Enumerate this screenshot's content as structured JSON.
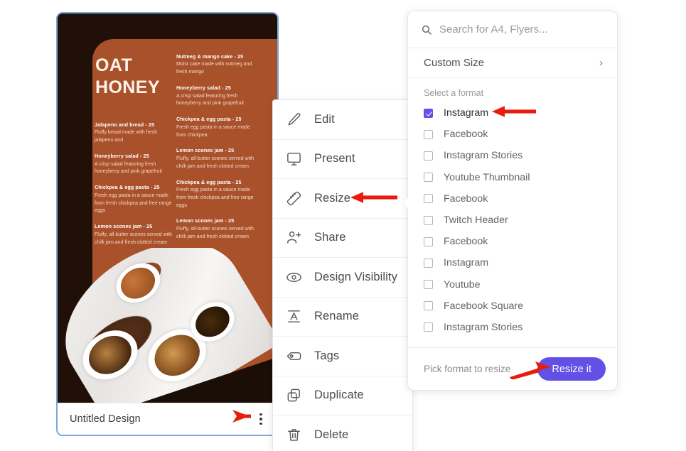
{
  "design_card": {
    "title": "Untitled Design",
    "kebab_icon": "more-vertical-icon",
    "thumbnail": {
      "brand_line1": "OAT",
      "brand_line2": "HONEY",
      "column_left": [
        {
          "title": "Jalapeno and bread - 25",
          "desc": "Fluffy bread made with fresh jalapeno and"
        },
        {
          "title": "Honeyberry salad - 25",
          "desc": "A crisp salad featuring fresh honeyberry and pink grapefruit"
        },
        {
          "title": "Chickpea & egg pasta - 25",
          "desc": "Fresh egg pasta in a sauce made from fresh chickpea and free range eggs"
        },
        {
          "title": "Lemon scones  jam - 25",
          "desc": "Fluffy, all-butter scones served with chilli jam and fresh clotted cream"
        }
      ],
      "column_right": [
        {
          "title": "Nutmeg & mango cake - 25",
          "desc": "Moist cake made with nutmeg and fresh mango"
        },
        {
          "title": "Honeyberry salad - 25",
          "desc": "A crisp salad featuring fresh honeyberry and pink grapefruit"
        },
        {
          "title": "Chickpea & egg pasta - 25",
          "desc": "Fresh egg pasta in a sauce made from chickpea"
        },
        {
          "title": "Lemon scones  jam - 25",
          "desc": "Fluffy, all-butter scones served with chilli jam and fresh clotted cream"
        },
        {
          "title": "Chickpea & egg pasta - 25",
          "desc": "Fresh egg pasta in a sauce made from fresh chickpea and free range eggs"
        },
        {
          "title": "Lemon scones  jam - 25",
          "desc": "Fluffy, all-butter scones served with chilli jam and fresh clotted cream"
        }
      ]
    }
  },
  "context_menu": {
    "items": [
      {
        "label": "Edit",
        "icon": "pencil-icon"
      },
      {
        "label": "Present",
        "icon": "monitor-icon"
      },
      {
        "label": "Resize",
        "icon": "ruler-icon"
      },
      {
        "label": "Share",
        "icon": "person-plus-icon"
      },
      {
        "label": "Design Visibility",
        "icon": "eye-icon"
      },
      {
        "label": "Rename",
        "icon": "text-a-icon"
      },
      {
        "label": "Tags",
        "icon": "tag-icon"
      },
      {
        "label": "Duplicate",
        "icon": "copy-icon"
      },
      {
        "label": "Delete",
        "icon": "trash-icon"
      }
    ]
  },
  "resize_panel": {
    "search": {
      "placeholder": "Search for A4, Flyers...",
      "value": "",
      "icon": "search-icon"
    },
    "custom_size": {
      "label": "Custom Size",
      "chevron": "chevron-right-icon"
    },
    "section_label": "Select a format",
    "formats": [
      {
        "label": "Instagram",
        "checked": true
      },
      {
        "label": "Facebook",
        "checked": false
      },
      {
        "label": "Instagram Stories",
        "checked": false
      },
      {
        "label": "Youtube Thumbnail",
        "checked": false
      },
      {
        "label": "Facebook",
        "checked": false
      },
      {
        "label": "Twitch Header",
        "checked": false
      },
      {
        "label": "Facebook",
        "checked": false
      },
      {
        "label": "Instagram",
        "checked": false
      },
      {
        "label": "Youtube",
        "checked": false
      },
      {
        "label": "Facebook Square",
        "checked": false
      },
      {
        "label": "Instagram Stories",
        "checked": false
      }
    ],
    "footer": {
      "hint": "Pick format to resize",
      "button_label": "Resize it"
    }
  },
  "annotations": {
    "arrow_color": "#E81C0C",
    "arrows": [
      {
        "name": "arrow-to-kebab-menu"
      },
      {
        "name": "arrow-to-resize-item"
      },
      {
        "name": "arrow-to-instagram-format"
      },
      {
        "name": "arrow-to-resize-it-button"
      }
    ]
  },
  "colors": {
    "accent_purple": "#6350e6",
    "card_border_blue": "#79a9d6",
    "menu_brown": "#a9512b",
    "thumb_dark": "#201008"
  }
}
